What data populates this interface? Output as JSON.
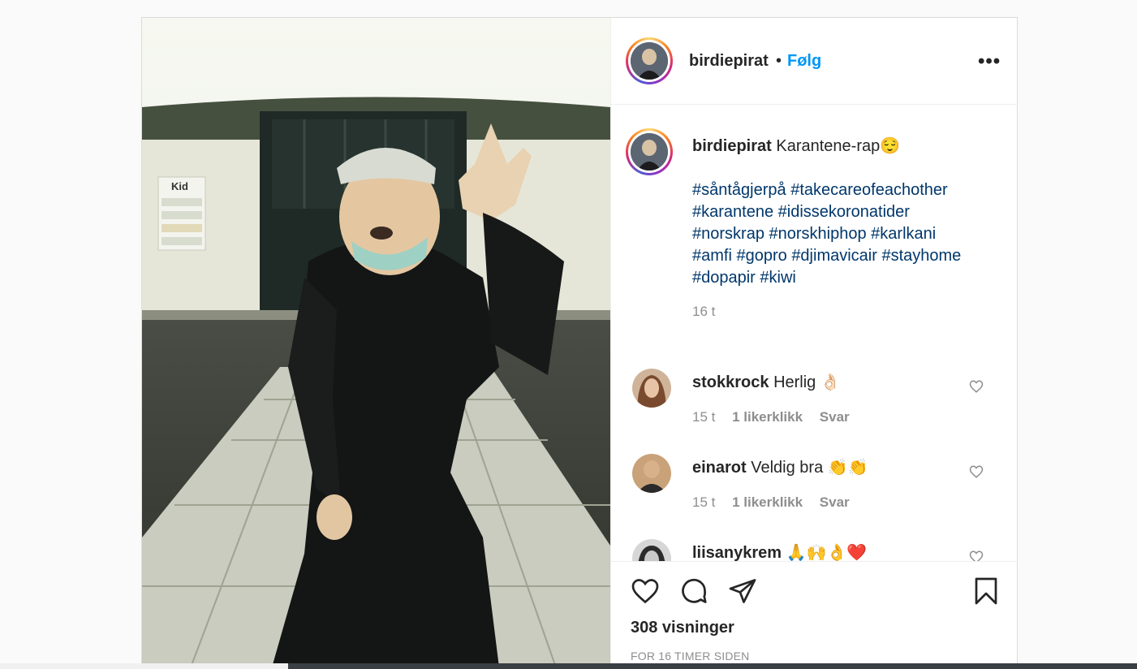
{
  "post": {
    "username": "birdiepirat",
    "separator": "•",
    "follow_label": "Følg",
    "more_label": "•••",
    "caption_text": "Karantene-rap😌",
    "hashtags": [
      "#såntågjerpå",
      "#takecareofeachother",
      "#karantene",
      "#idissekoronatider",
      "#norskrap",
      "#norskhiphop",
      "#karlkani",
      "#amfi",
      "#gopro",
      "#djimavicair",
      "#stayhome",
      "#dopapir",
      "#kiwi"
    ],
    "caption_time": "16 t",
    "views": "308 visninger",
    "posted": "FOR 16 TIMER SIDEN"
  },
  "comments": [
    {
      "username": "stokkrock",
      "text": "Herlig 👌🏻",
      "time": "15 t",
      "likes": "1 likerklikk",
      "reply": "Svar"
    },
    {
      "username": "einarot",
      "text": "Veldig bra 👏👏",
      "time": "15 t",
      "likes": "1 likerklikk",
      "reply": "Svar"
    },
    {
      "username": "liisanykrem",
      "text": "🙏🙌👌❤️"
    }
  ],
  "media_sign": "Kid",
  "icons": {
    "like": "heart-icon",
    "comment": "comment-icon",
    "share": "paper-plane-icon",
    "save": "bookmark-icon",
    "comment_like": "heart-outline-icon",
    "options": "more-options-icon"
  },
  "colors": {
    "follow": "#0095f6",
    "hashtag": "#00376b",
    "muted": "#8e8e8e",
    "text": "#262626"
  }
}
